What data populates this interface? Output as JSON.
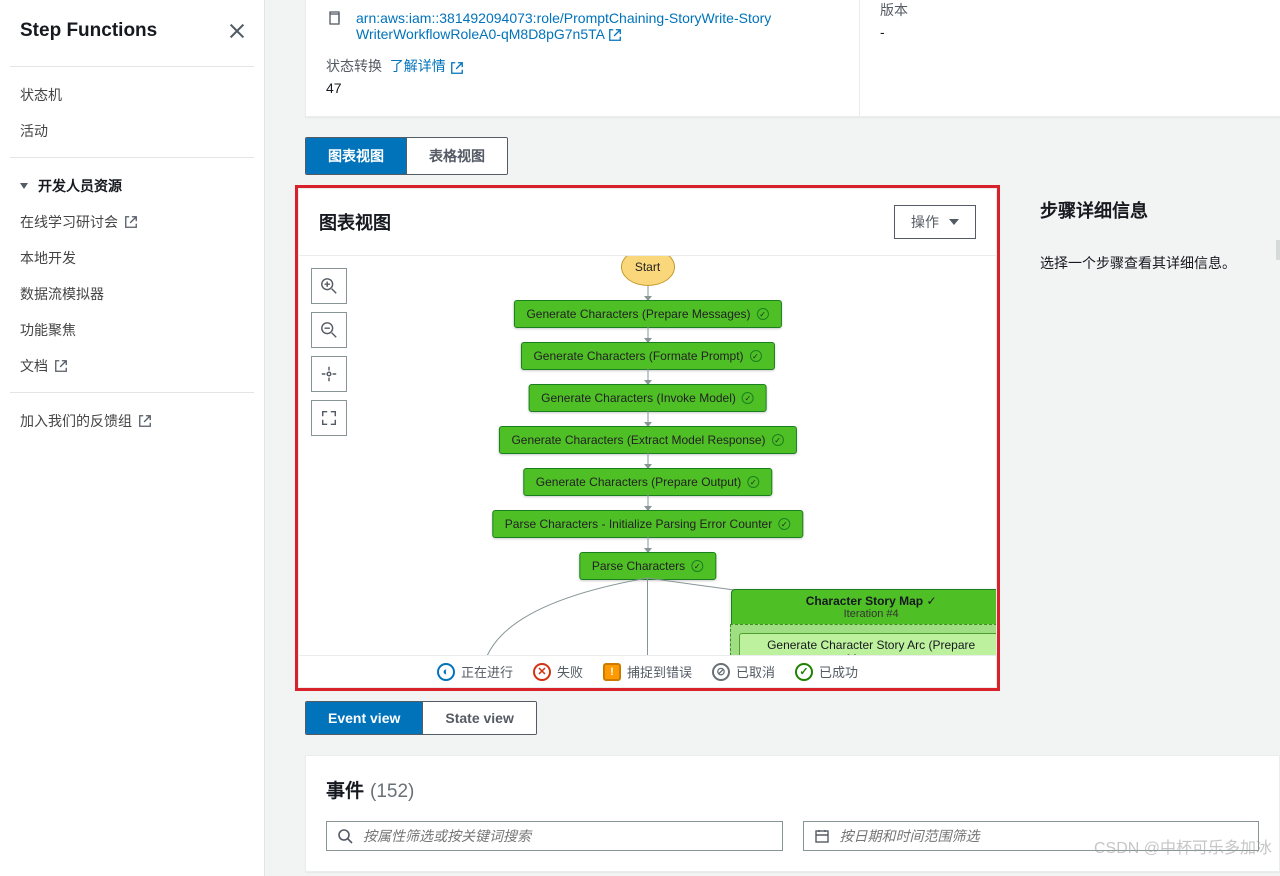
{
  "sidebar": {
    "title": "Step Functions",
    "items": [
      {
        "label": "状态机"
      },
      {
        "label": "活动"
      }
    ],
    "dev_section": "开发人员资源",
    "dev_items": [
      {
        "label": "在线学习研讨会",
        "ext": true
      },
      {
        "label": "本地开发"
      },
      {
        "label": "数据流模拟器"
      },
      {
        "label": "功能聚焦"
      },
      {
        "label": "文档",
        "ext": true
      }
    ],
    "feedback": "加入我们的反馈组"
  },
  "detail": {
    "arn": "arn:aws:iam::381492094073:role/PromptChaining-StoryWrite-StoryWriterWorkflowRoleA0-qM8D8pG7n5TA",
    "transitions_label": "状态转换",
    "learn_more": "了解详情",
    "transitions_value": "47",
    "version_label": "版本",
    "version_value": "-"
  },
  "view_tabs": {
    "graph": "图表视图",
    "table": "表格视图"
  },
  "graph": {
    "title": "图表视图",
    "action": "操作",
    "nodes": {
      "start": "Start",
      "n1": "Generate Characters (Prepare Messages)",
      "n2": "Generate Characters (Formate Prompt)",
      "n3": "Generate Characters (Invoke Model)",
      "n4": "Generate Characters (Extract Model Response)",
      "n5": "Generate Characters (Prepare Output)",
      "n6": "Parse Characters - Initialize Parsing Error Counter",
      "n7": "Parse Characters",
      "map_title": "Character Story Map",
      "map_iter": "Iteration #4",
      "map_n1": "Generate Character Story Arc (Prepare Message"
    }
  },
  "legend": {
    "progress": "正在进行",
    "failed": "失败",
    "caught": "捕捉到错误",
    "cancelled": "已取消",
    "success": "已成功"
  },
  "step_detail": {
    "title": "步骤详细信息",
    "hint": "选择一个步骤查看其详细信息。"
  },
  "event_tabs": {
    "event": "Event view",
    "state": "State view"
  },
  "events": {
    "title": "事件",
    "count": "(152)",
    "search_ph": "按属性筛选或按关键词搜索",
    "date_ph": "按日期和时间范围筛选"
  },
  "watermark": "CSDN @中杯可乐多加冰"
}
